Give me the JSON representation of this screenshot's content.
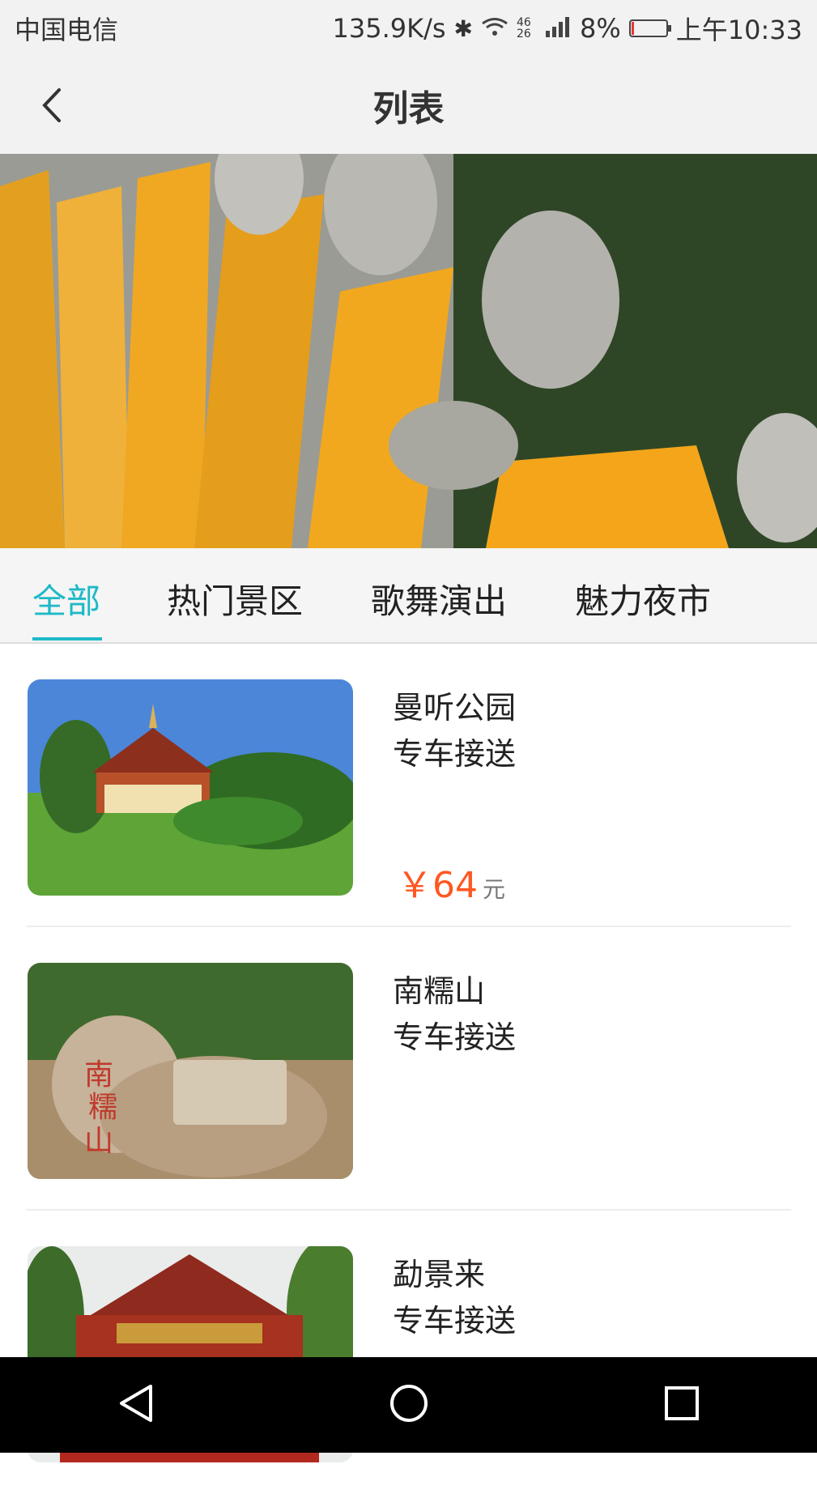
{
  "status_bar": {
    "carrier": "中国电信",
    "speed": "135.9K/s",
    "network": "46 26",
    "battery": "8%",
    "time": "上午10:33",
    "battery_level": 0.08
  },
  "header": {
    "title": "列表",
    "back_icon": "chevron-left-icon"
  },
  "banner": {
    "slides": 6,
    "active_slide": 6
  },
  "tabs": [
    {
      "label": "全部",
      "active": true
    },
    {
      "label": "热门景区",
      "active": false
    },
    {
      "label": "歌舞演出",
      "active": false
    },
    {
      "label": "魅力夜市",
      "active": false
    }
  ],
  "list": [
    {
      "name": "曼听公园",
      "service": "专车接送",
      "price_symbol": "￥",
      "price": "64",
      "unit": "元"
    },
    {
      "name": "南糯山",
      "service": "专车接送"
    },
    {
      "name": "勐景来",
      "service": "专车接送"
    }
  ],
  "colors": {
    "accent": "#1fb9c8",
    "price": "#ff5722"
  },
  "nav": {
    "icons": [
      "back-triangle-icon",
      "home-circle-icon",
      "recents-square-icon"
    ]
  }
}
